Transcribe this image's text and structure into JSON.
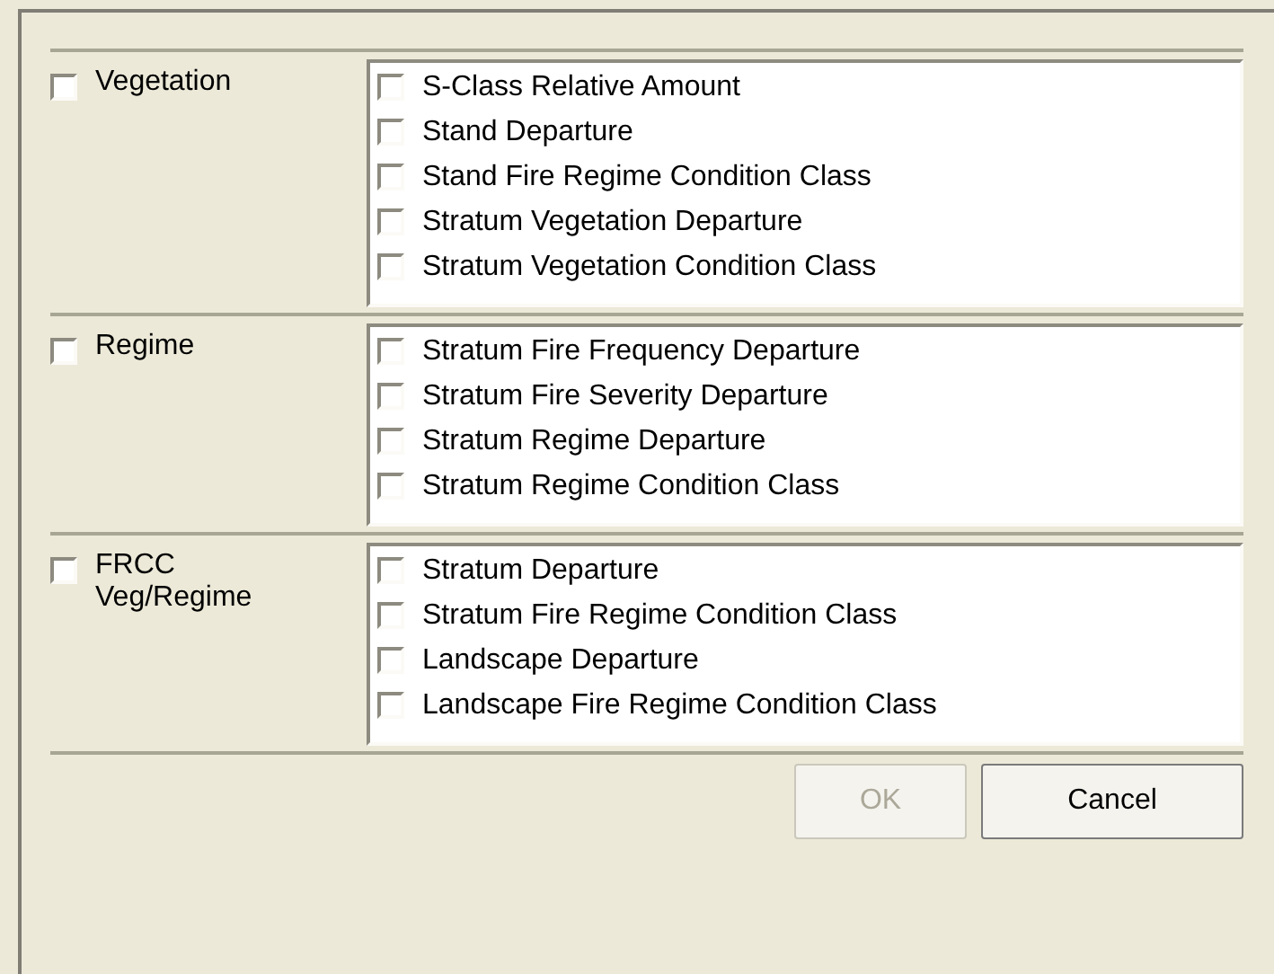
{
  "groups": [
    {
      "label": "Vegetation",
      "checked": false,
      "items": [
        {
          "label": "S-Class Relative Amount",
          "checked": false
        },
        {
          "label": "Stand Departure",
          "checked": false
        },
        {
          "label": "Stand Fire Regime Condition Class",
          "checked": false
        },
        {
          "label": "Stratum Vegetation Departure",
          "checked": false
        },
        {
          "label": "Stratum Vegetation Condition Class",
          "checked": false
        }
      ]
    },
    {
      "label": "Regime",
      "checked": false,
      "items": [
        {
          "label": "Stratum Fire Frequency Departure",
          "checked": false
        },
        {
          "label": "Stratum Fire Severity Departure",
          "checked": false
        },
        {
          "label": "Stratum Regime Departure",
          "checked": false
        },
        {
          "label": "Stratum Regime Condition Class",
          "checked": false
        }
      ]
    },
    {
      "label": "FRCC\nVeg/Regime",
      "checked": false,
      "items": [
        {
          "label": "Stratum Departure",
          "checked": false
        },
        {
          "label": "Stratum Fire Regime Condition Class",
          "checked": false
        },
        {
          "label": "Landscape Departure",
          "checked": false
        },
        {
          "label": "Landscape Fire Regime Condition Class",
          "checked": false
        }
      ]
    }
  ],
  "buttons": [
    {
      "label": "OK",
      "disabled": true
    },
    {
      "label": "Cancel",
      "disabled": false
    }
  ]
}
